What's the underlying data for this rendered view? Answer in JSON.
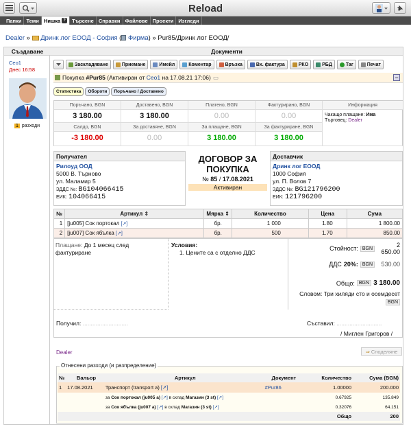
{
  "app": {
    "title": "Reload"
  },
  "nav": [
    "Папки",
    "Теми",
    "Нишка",
    "Търсене",
    "Справки",
    "Файлове",
    "Проекти",
    "Изгледи"
  ],
  "breadcrumb": {
    "root": "Dealer",
    "sep1": "»",
    "company": "Дринк лог ЕООД - София",
    "firm_label": "Фирма",
    "sep2": "»",
    "current": "Pur85/Дринк лог ЕООД/"
  },
  "columns": {
    "left": "Създаване",
    "right": "Документи"
  },
  "author": {
    "name": "Ceo1",
    "date": "Днес 16:58",
    "badge": "1",
    "badge_label": "разходи"
  },
  "toolbar": [
    "Заскладяване",
    "Приемане",
    "Имейл",
    "Коментар",
    "Връзка",
    "Вх. фактура",
    "РКО",
    "РБД",
    "Таг",
    "Печат"
  ],
  "doc_line": {
    "prefix": "Покупка",
    "num": "#Pur85",
    "mid": "(Активиран от",
    "user": "Ceo1",
    "rest": "на 17.08.21 17:06)"
  },
  "subtabs": [
    "Статистика",
    "Обороти",
    "Поръчано / Доставено"
  ],
  "stats": {
    "ordered_label": "Поръчано, BGN",
    "ordered": "3 180.00",
    "delivered_label": "Доставено, BGN",
    "delivered": "3 180.00",
    "paid_label": "Платено, BGN",
    "paid": "0.00",
    "invoiced_label": "Фактурирано, BGN",
    "invoiced": "0.00",
    "info_label": "Информация",
    "balance_label": "Салдо, BGN",
    "balance": "-3 180.00",
    "to_deliver_label": "За доставяне, BGN",
    "to_deliver": "0.00",
    "to_pay_label": "За плащане, BGN",
    "to_pay": "3 180.00",
    "to_invoice_label": "За фактуриране, BGN",
    "to_invoice": "3 180.00",
    "pending_label": "Чакащо плащане:",
    "pending": "Има",
    "trader_label": "Търговец:",
    "trader": "Dealer"
  },
  "receiver": {
    "title": "Получател",
    "name": "Рилоуд ООД",
    "city": "5000 В. Търново",
    "street": "ул. Маламир 5",
    "vat_label": "ЗДДС №:",
    "vat": "BG104066415",
    "eik_label": "ЕИК:",
    "eik": "104066415"
  },
  "contract": {
    "title1": "ДОГОВОР ЗА",
    "title2": "ПОКУПКА",
    "num_label": "№",
    "num": "85",
    "date": "17.08.2021",
    "status": "Активиран"
  },
  "supplier": {
    "title": "Доставчик",
    "name": "Дринк лог ЕООД",
    "city": "1000 София",
    "street": "ул. П. Волов 7",
    "vat_label": "ЗДДС №:",
    "vat": "BG121796200",
    "eik_label": "ЕИК:",
    "eik": "121796200"
  },
  "items_header": [
    "№",
    "Артикул",
    "Мярка",
    "Количество",
    "Цена",
    "Сума"
  ],
  "items": [
    {
      "n": "1",
      "code": "[ju005",
      "name": "Сок портокал",
      "unit": "бр.",
      "qty": "1 000",
      "price": "1.80",
      "sum": "1 800.00"
    },
    {
      "n": "2",
      "code": "[ju007",
      "name": "Сок ябълка",
      "unit": "бр.",
      "qty": "500",
      "price": "1.70",
      "sum": "850.00"
    }
  ],
  "terms": {
    "pay_label": "Плащане:",
    "pay": "До 1 месец след фактуриране",
    "cond_label": "Условия:",
    "cond1": "1. Цените са с отделно ДДС"
  },
  "totals": {
    "value_label": "Стойност:",
    "cur": "BGN",
    "value": "2 650.00",
    "vat_label": "ДДС",
    "vat_pct": "20%:",
    "vat": "530.00",
    "total_label": "Общо:",
    "total": "3 180.00",
    "words_label": "Словом:",
    "words": "Три хиляди сто и осемдесет"
  },
  "sign": {
    "received": "Получил:",
    "composed": "Съставил:",
    "composer": "/ Миглен Григоров /"
  },
  "footer": {
    "dealer": "Dealer",
    "share": "Споделяне"
  },
  "expenses": {
    "title": "Отнесени разходи (и разпределение)",
    "header": [
      "№",
      "Вальор",
      "Артикул",
      "Документ",
      "Количество",
      "Сума (BGN)"
    ],
    "main": {
      "n": "1",
      "date": "17.08.2021",
      "article": "Транспорт (transport a)",
      "doc": "#Pur86",
      "qty": "1.00000",
      "sum": "200.000"
    },
    "splits": [
      {
        "pre": "за",
        "art": "Сок портокал (ju005 a)",
        "mid": "в склад",
        "store": "Магазин (3 st)",
        "qty": "0.67925",
        "sum": "135.849"
      },
      {
        "pre": "за",
        "art": "Сок ябълка (ju007 a)",
        "mid": "в склад",
        "store": "Магазин (3 st)",
        "qty": "0.32076",
        "sum": "64.151"
      }
    ],
    "total_label": "Общо",
    "total": "200"
  }
}
